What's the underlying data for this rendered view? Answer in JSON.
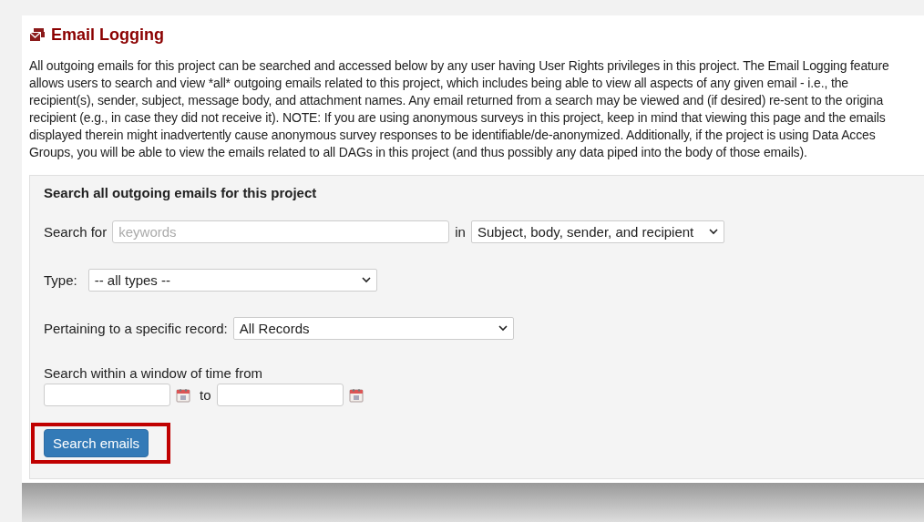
{
  "page": {
    "title": "Email Logging",
    "description_lines": [
      "All outgoing emails for this project can be searched and accessed below by any user having User Rights privileges in this project. The Email Logging feature",
      "allows users to search and view *all* outgoing emails related to this project, which includes being able to view all aspects of any given email - i.e., the",
      "recipient(s), sender, subject, message body, and attachment names. Any email returned from a search may be viewed and (if desired) re-sent to the origina",
      "recipient (e.g., in case they did not receive it). NOTE: If you are using anonymous surveys in this project, keep in mind that viewing this page and the emails",
      "displayed therein might inadvertently cause anonymous survey responses to be identifiable/de-anonymized. Additionally, if the project is using Data Acces",
      "Groups, you will be able to view the emails related to all DAGs in this project (and thus possibly any data piped into the body of those emails)."
    ]
  },
  "search_panel": {
    "title": "Search all outgoing emails for this project",
    "search_label": "Search for",
    "search_placeholder": "keywords",
    "in_label": "in",
    "scope_select": "Subject, body, sender, and recipient",
    "type_label": "Type:",
    "type_select": "-- all types --",
    "record_label": "Pertaining to a specific record:",
    "record_select": "All Records",
    "time_label": "Search within a window of time from",
    "to_label": "to",
    "search_button": {
      "label": "Search emails",
      "highlighted": true
    }
  }
}
